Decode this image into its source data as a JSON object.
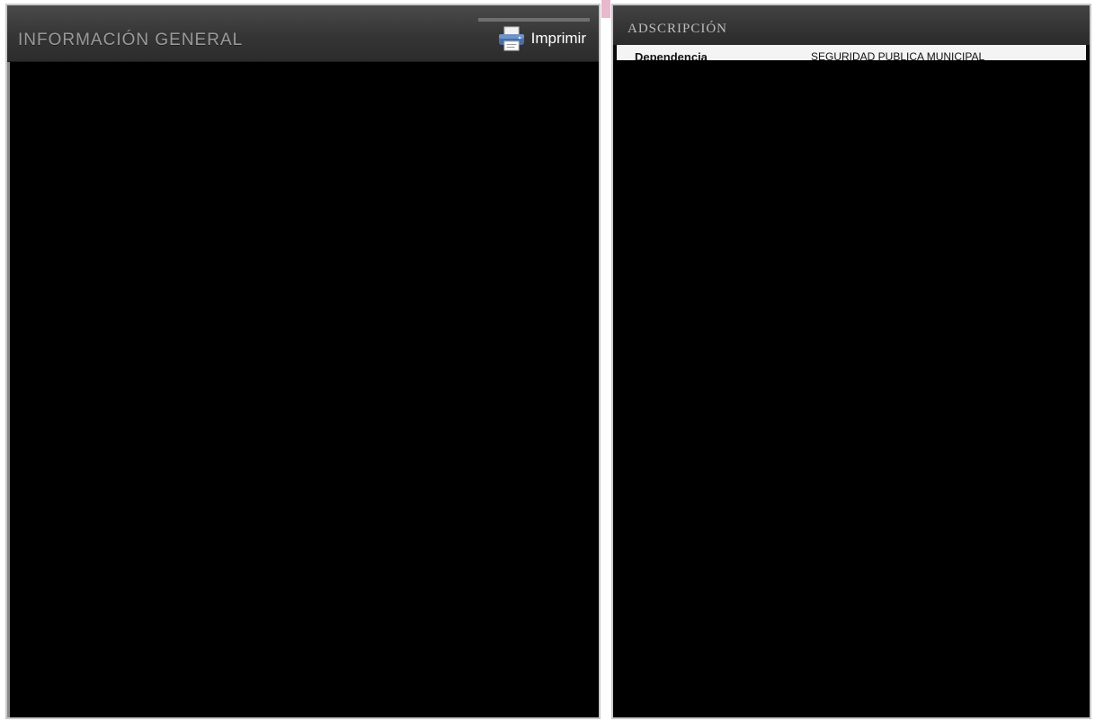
{
  "general_info": {
    "title": "INFORMACIÓN GENERAL",
    "print_button": {
      "label": "Imprimir",
      "icon": "printer-icon"
    }
  },
  "adscripcion": {
    "title": "ADSCRIPCIÓN",
    "rows": [
      {
        "label": "Dependencia",
        "value": "SEGURIDAD PUBLICA MUNICIPAL"
      }
    ]
  },
  "colors": {
    "panel_background": "#000000",
    "header_gradient_top": "#4a4a4a",
    "header_title": "#9a9a9a",
    "divider_accent": "#e8b8cc"
  }
}
